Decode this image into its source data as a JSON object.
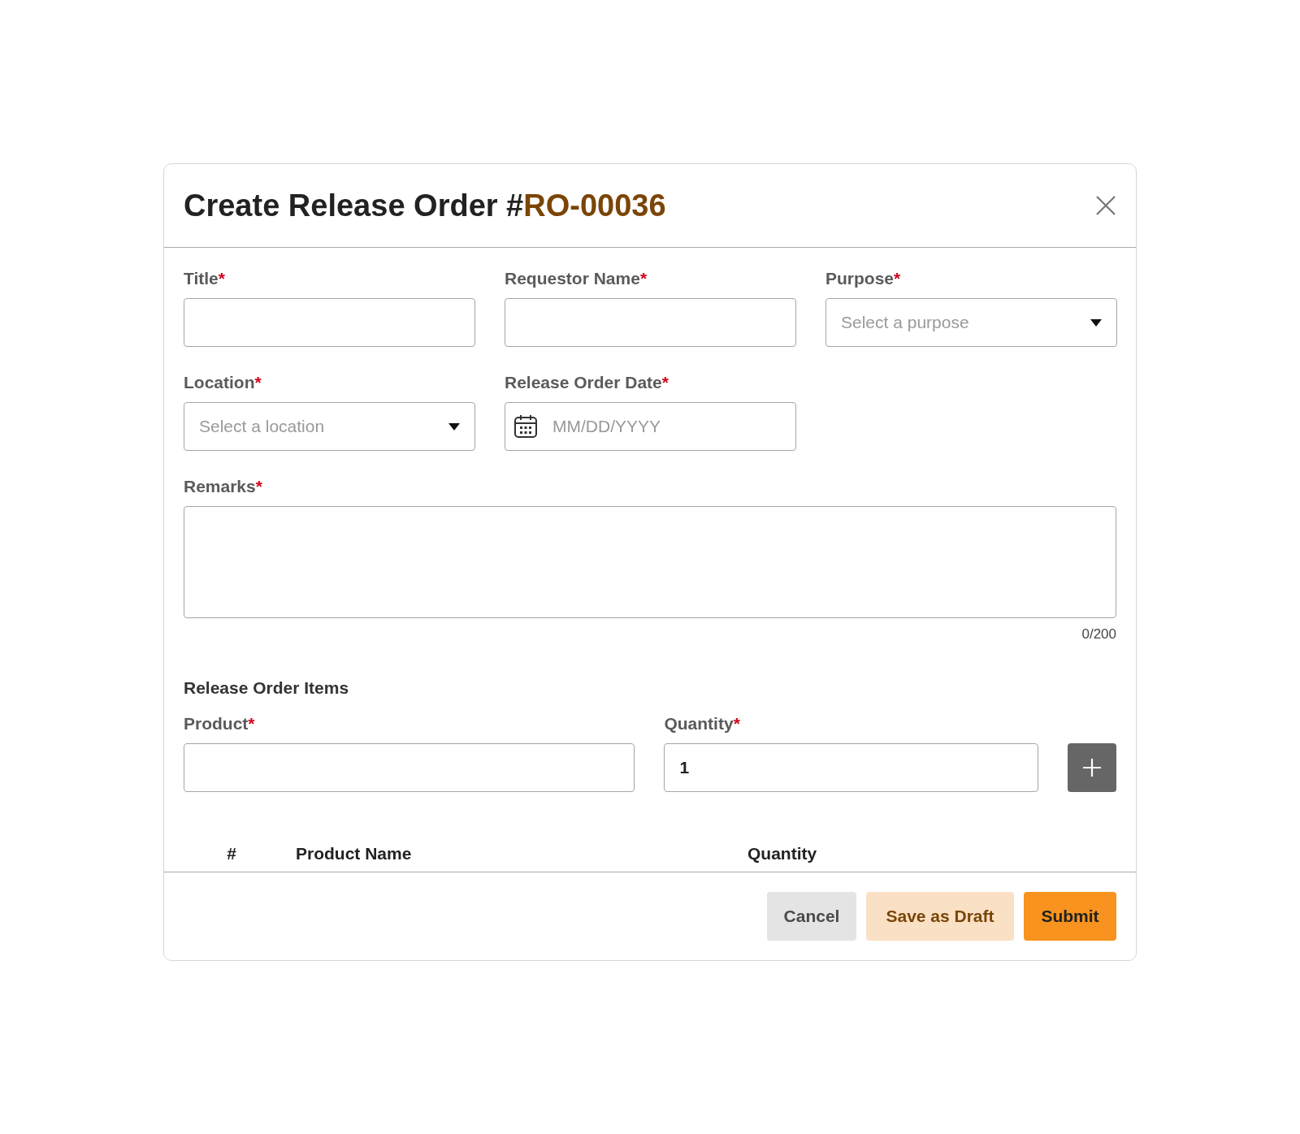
{
  "dialog": {
    "title": "Create Release Order #",
    "order_number": "RO-00036"
  },
  "fields": [
    {
      "kind": "text",
      "label": "Title",
      "required_mark": "*"
    },
    {
      "kind": "text",
      "label": "Requestor Name",
      "required_mark": "*"
    },
    {
      "kind": "select",
      "label": "Purpose",
      "required_mark": "*",
      "placeholder": "Select a purpose"
    },
    {
      "kind": "select",
      "label": "Location",
      "required_mark": "*",
      "placeholder": "Select a location"
    },
    {
      "kind": "date",
      "label": "Release Order Date",
      "required_mark": "*",
      "placeholder": "MM/DD/YYYY"
    }
  ],
  "remarks": {
    "label": "Remarks",
    "required_mark": "*",
    "counter": "0/200"
  },
  "items_section": {
    "heading": "Release Order Items",
    "product": {
      "label": "Product",
      "required_mark": "*"
    },
    "quantity": {
      "label": "Quantity",
      "required_mark": "*",
      "value": "1"
    }
  },
  "table": {
    "columns": [
      "#",
      "Product Name",
      "Quantity"
    ]
  },
  "buttons": [
    {
      "kind": "secondary",
      "label": "Cancel"
    },
    {
      "kind": "draft",
      "label": "Save as Draft"
    },
    {
      "kind": "primary",
      "label": "Submit"
    }
  ]
}
